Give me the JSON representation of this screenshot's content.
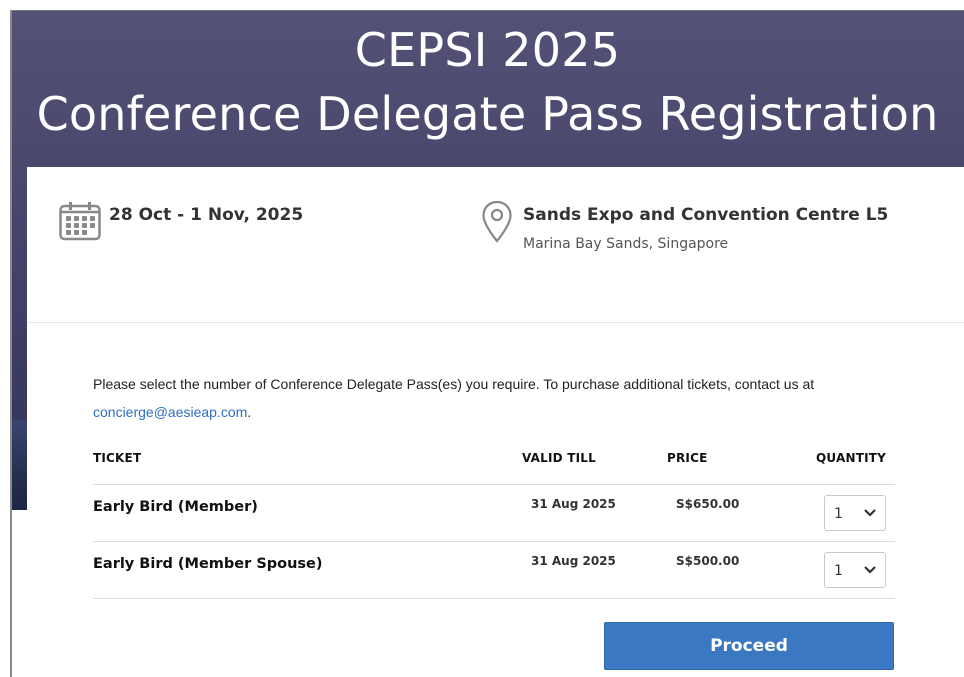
{
  "hero": {
    "title_line1": "CEPSI 2025",
    "title_line2": "Conference Delegate Pass Registration"
  },
  "event": {
    "date": "28 Oct - 1 Nov, 2025",
    "date_icon": "calendar-icon",
    "venue_name": "Sands Expo and Convention Centre L5",
    "venue_address": "Marina Bay Sands, Singapore",
    "venue_icon": "map-pin-icon"
  },
  "intro": {
    "text": "Please select the number of Conference Delegate Pass(es) you require. To purchase additional tickets, contact us at ",
    "email": "concierge@aesieap.com",
    "suffix": "."
  },
  "table": {
    "headers": {
      "ticket": "TICKET",
      "valid_till": "VALID TILL",
      "price": "PRICE",
      "quantity": "QUANTITY"
    },
    "rows": [
      {
        "name": "Early Bird (Member)",
        "valid_till": "31 Aug 2025",
        "price": "S$650.00",
        "quantity": "1"
      },
      {
        "name": "Early Bird (Member Spouse)",
        "valid_till": "31 Aug 2025",
        "price": "S$500.00",
        "quantity": "1"
      }
    ]
  },
  "actions": {
    "proceed_label": "Proceed"
  },
  "colors": {
    "hero_bg": "#4d4a70",
    "accent": "#3a78c3",
    "link": "#2e6fc0"
  }
}
